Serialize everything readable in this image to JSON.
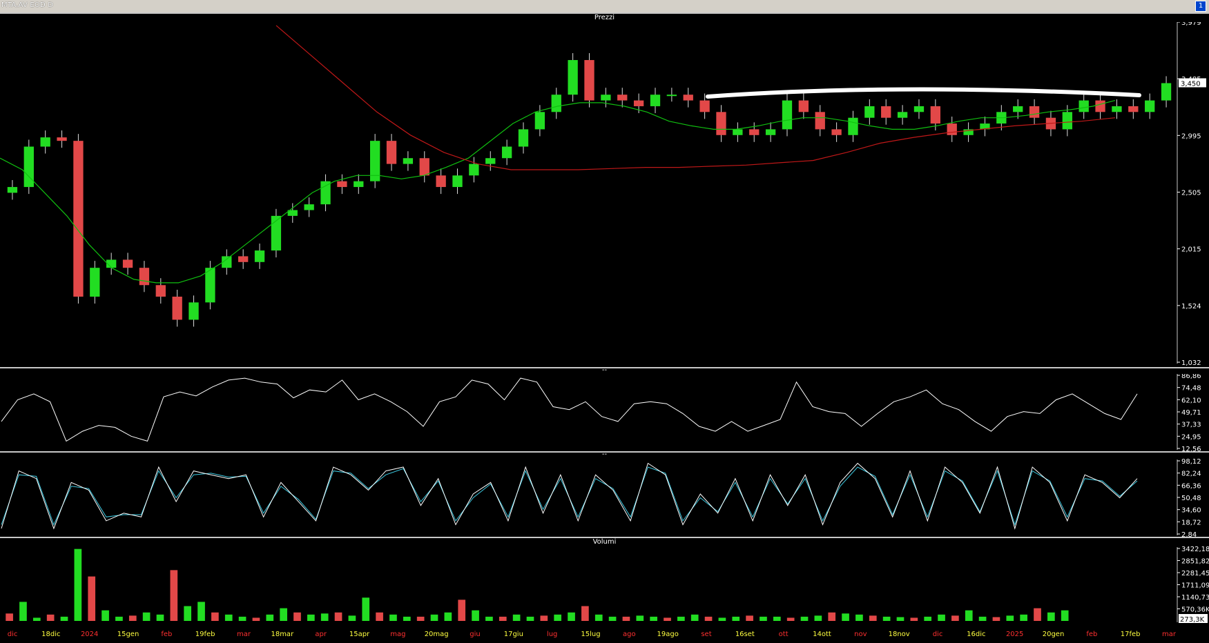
{
  "window": {
    "title": "MTA.AV EOD D",
    "button_label": "1"
  },
  "panels": {
    "price": "Prezzi",
    "rsi": "--",
    "stoch": "--",
    "volume": "Volumi"
  },
  "colors": {
    "up": "#22dd22",
    "down": "#e24848",
    "ma_short": "#10c010",
    "ma_long": "#c01818",
    "rsi": "#ffffff",
    "stoch_k": "#ffffff",
    "stoch_d": "#3cc8e0",
    "resistance": "#ffffff"
  },
  "chart_data": [
    {
      "type": "candlestick",
      "title": "Prezzi",
      "y_ticks": [
        "3,979",
        "3,485",
        "2,995",
        "2,505",
        "2,015",
        "1,524",
        "1,032"
      ],
      "ylim": [
        1.032,
        3.979
      ],
      "last_price_label": "3,450",
      "x_ticks": [
        "dic",
        "18dic",
        "2024",
        "15gen",
        "feb",
        "19feb",
        "mar",
        "18mar",
        "apr",
        "15apr",
        "mag",
        "20mag",
        "giu",
        "17giu",
        "lug",
        "15lug",
        "ago",
        "19ago",
        "set",
        "16set",
        "ott",
        "14ott",
        "nov",
        "18nov",
        "dic",
        "16dic",
        "2025",
        "20gen",
        "feb",
        "17feb",
        "mar"
      ],
      "close_series": [
        2.55,
        2.9,
        2.98,
        2.95,
        1.6,
        1.85,
        1.92,
        1.85,
        1.7,
        1.6,
        1.4,
        1.55,
        1.85,
        1.95,
        1.9,
        2.0,
        2.3,
        2.35,
        2.4,
        2.6,
        2.55,
        2.6,
        2.95,
        2.75,
        2.8,
        2.65,
        2.55,
        2.65,
        2.75,
        2.8,
        2.9,
        3.05,
        3.2,
        3.35,
        3.65,
        3.3,
        3.35,
        3.3,
        3.25,
        3.35,
        3.35,
        3.3,
        3.2,
        3.0,
        3.05,
        3.0,
        3.05,
        3.3,
        3.2,
        3.05,
        3.0,
        3.15,
        3.25,
        3.15,
        3.2,
        3.25,
        3.1,
        3.0,
        3.05,
        3.1,
        3.2,
        3.25,
        3.15,
        3.05,
        3.2,
        3.3,
        3.2,
        3.25,
        3.2,
        3.3,
        3.45
      ],
      "series": [
        {
          "name": "media breve",
          "values": [
            2.8,
            2.7,
            2.5,
            2.3,
            2.05,
            1.85,
            1.75,
            1.72,
            1.72,
            1.78,
            1.9,
            2.05,
            2.2,
            2.35,
            2.5,
            2.6,
            2.65,
            2.65,
            2.62,
            2.65,
            2.72,
            2.8,
            2.95,
            3.1,
            3.2,
            3.25,
            3.28,
            3.28,
            3.25,
            3.2,
            3.12,
            3.08,
            3.05,
            3.05,
            3.08,
            3.12,
            3.15,
            3.15,
            3.12,
            3.08,
            3.05,
            3.05,
            3.08,
            3.12,
            3.15,
            3.15,
            3.17,
            3.2,
            3.22,
            3.25,
            3.3
          ]
        },
        {
          "name": "media lunga",
          "values": [
            3.95,
            3.7,
            3.45,
            3.2,
            3.0,
            2.85,
            2.75,
            2.7,
            2.7,
            2.7,
            2.71,
            2.72,
            2.72,
            2.73,
            2.74,
            2.76,
            2.78,
            2.85,
            2.93,
            2.98,
            3.02,
            3.05,
            3.08,
            3.1,
            3.12,
            3.15
          ]
        }
      ],
      "resistance_label": "",
      "grid": false
    },
    {
      "type": "line",
      "title": "",
      "y_ticks": [
        "86,86",
        "74,48",
        "62,10",
        "49,71",
        "37,33",
        "24,95",
        "12,56"
      ],
      "ylim": [
        12.56,
        86.86
      ],
      "values": [
        40,
        62,
        68,
        60,
        20,
        30,
        36,
        34,
        25,
        20,
        65,
        70,
        66,
        75,
        82,
        84,
        80,
        78,
        64,
        72,
        70,
        82,
        62,
        68,
        60,
        50,
        35,
        60,
        65,
        82,
        78,
        62,
        84,
        80,
        55,
        52,
        60,
        45,
        40,
        58,
        60,
        58,
        48,
        35,
        30,
        40,
        30,
        36,
        42,
        80,
        55,
        50,
        48,
        35,
        48,
        60,
        65,
        72,
        58,
        52,
        40,
        30,
        45,
        50,
        48,
        62,
        68,
        58,
        48,
        42,
        68
      ]
    },
    {
      "type": "line",
      "title": "",
      "y_ticks": [
        "98,12",
        "82,24",
        "66,36",
        "50,48",
        "34,60",
        "18,72",
        "2,84"
      ],
      "ylim": [
        2.84,
        98.12
      ],
      "series": [
        {
          "name": "%K",
          "values": [
            10,
            85,
            75,
            10,
            70,
            60,
            20,
            30,
            25,
            90,
            45,
            85,
            80,
            75,
            80,
            25,
            70,
            45,
            20,
            90,
            80,
            60,
            85,
            90,
            40,
            75,
            15,
            55,
            70,
            20,
            90,
            30,
            80,
            20,
            80,
            60,
            20,
            95,
            80,
            15,
            55,
            30,
            75,
            20,
            80,
            40,
            80,
            15,
            70,
            95,
            75,
            25,
            85,
            20,
            90,
            70,
            30,
            90,
            10,
            90,
            70,
            20,
            80,
            70,
            50,
            75
          ]
        },
        {
          "name": "%D",
          "values": [
            15,
            80,
            78,
            15,
            65,
            62,
            25,
            28,
            28,
            85,
            50,
            80,
            82,
            77,
            78,
            30,
            65,
            48,
            22,
            85,
            82,
            62,
            80,
            88,
            45,
            72,
            20,
            50,
            68,
            25,
            85,
            35,
            75,
            25,
            75,
            62,
            25,
            90,
            82,
            20,
            50,
            32,
            70,
            25,
            75,
            42,
            75,
            20,
            65,
            90,
            78,
            28,
            80,
            25,
            85,
            72,
            32,
            85,
            15,
            85,
            72,
            25,
            75,
            72,
            52,
            72
          ]
        }
      ]
    },
    {
      "type": "bar",
      "title": "Volumi",
      "y_ticks": [
        "3422,18K",
        "2851,82K",
        "2281,45K",
        "1711,09K",
        "1140,73K",
        "570,36K"
      ],
      "ylim": [
        0,
        3422.18
      ],
      "last_value_label": "273,3K",
      "values": [
        350,
        900,
        150,
        300,
        200,
        3400,
        2100,
        500,
        200,
        250,
        400,
        300,
        2400,
        700,
        900,
        400,
        300,
        200,
        150,
        300,
        600,
        400,
        300,
        350,
        400,
        250,
        1100,
        400,
        300,
        200,
        200,
        300,
        400,
        1000,
        500,
        200,
        200,
        300,
        200,
        250,
        300,
        400,
        700,
        300,
        200,
        200,
        250,
        200,
        150,
        200,
        300,
        200,
        150,
        200,
        250,
        200,
        200,
        150,
        200,
        250,
        400,
        350,
        300,
        250,
        200,
        180,
        150,
        200,
        300,
        250,
        500,
        200,
        180,
        250,
        300,
        600,
        400,
        500
      ]
    }
  ]
}
